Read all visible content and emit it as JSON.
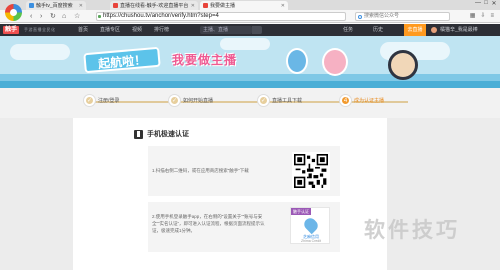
{
  "browser": {
    "tabs": [
      {
        "label": "触手tv_百度搜索"
      },
      {
        "label": "直播在线看-触手-欢迎直播平台"
      },
      {
        "label": "我要做主播",
        "active": true
      }
    ],
    "url": "https://chushou.tv/anchor/verify.htm?step=4",
    "search_placeholder": "搜索微信公众号",
    "window_controls": [
      "—",
      "□",
      "✕"
    ]
  },
  "site": {
    "logo": "触手",
    "slogan": "手游直播全民化",
    "nav": [
      "首页",
      "直播专区",
      "视频",
      "排行榜"
    ],
    "search_placeholder": "主播、直播",
    "task_label": "任务",
    "history_label": "历史",
    "open_live_label": "去直播",
    "username": "橘猫辛_我是最棒"
  },
  "banner": {
    "ribbon_text": "起航啦！",
    "slogan": "我要做主播"
  },
  "steps": [
    {
      "num": "✓",
      "label": "注册/登录"
    },
    {
      "num": "✓",
      "label": "如何开始直播"
    },
    {
      "num": "✓",
      "label": "直播工具下载"
    },
    {
      "num": "4",
      "label": "成为认证主播",
      "current": true
    }
  ],
  "section": {
    "title": "手机极速认证",
    "card1_text": "1.扫描右侧二维码，或在应用商店搜索“触手”下载",
    "card2_line1": "2.使用手机登录触手app，在右侧的“设置关于”“账号与安",
    "card2_line2": "全”“实名认证”，即可进入认证流程，根据页面流程提示认",
    "card2_line3": "证，极速完成1分钟。",
    "app_tag": "触手认证",
    "app_name": "芝麻信用",
    "app_sub": "Zhima Credit"
  },
  "watermark": "软件技巧",
  "colors": {
    "accent": "#f29a2e",
    "header_bg": "#2d2f36",
    "logo_red": "#ef4f4f",
    "banner_sky": "#bfe4f2",
    "step_done": "#e7cf9d"
  }
}
